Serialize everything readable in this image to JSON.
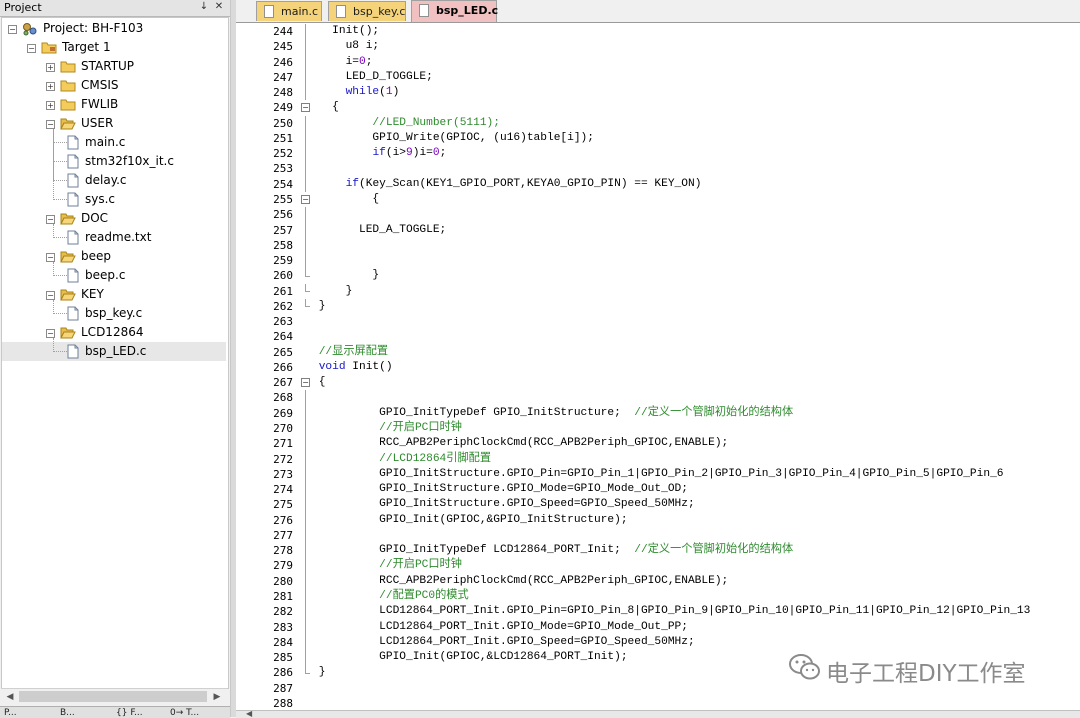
{
  "project_panel": {
    "title": "Project",
    "pin_glyph": "↓",
    "close_glyph": "✕",
    "tree": [
      {
        "label": "Project: BH-F103",
        "type": "project"
      },
      {
        "label": "Target 1",
        "type": "target"
      },
      {
        "label": "STARTUP",
        "type": "folder",
        "state": "collapsed"
      },
      {
        "label": "CMSIS",
        "type": "folder",
        "state": "collapsed"
      },
      {
        "label": "FWLIB",
        "type": "folder",
        "state": "collapsed"
      },
      {
        "label": "USER",
        "type": "folder",
        "state": "expanded"
      },
      {
        "label": "main.c",
        "type": "file"
      },
      {
        "label": "stm32f10x_it.c",
        "type": "file"
      },
      {
        "label": "delay.c",
        "type": "file"
      },
      {
        "label": "sys.c",
        "type": "file"
      },
      {
        "label": "DOC",
        "type": "folder",
        "state": "expanded"
      },
      {
        "label": "readme.txt",
        "type": "file"
      },
      {
        "label": "beep",
        "type": "folder",
        "state": "expanded"
      },
      {
        "label": "beep.c",
        "type": "file"
      },
      {
        "label": "KEY",
        "type": "folder",
        "state": "expanded"
      },
      {
        "label": "bsp_key.c",
        "type": "file"
      },
      {
        "label": "LCD12864",
        "type": "folder",
        "state": "expanded"
      },
      {
        "label": "bsp_LED.c",
        "type": "file",
        "selected": true
      }
    ],
    "bottom_tabs": [
      "P...",
      "B...",
      "{} F...",
      "0→ T..."
    ]
  },
  "editor": {
    "tabs": [
      {
        "label": "main.c",
        "active": false
      },
      {
        "label": "bsp_key.c",
        "active": false
      },
      {
        "label": "bsp_LED.c",
        "active": true
      }
    ],
    "lines": [
      {
        "n": "244",
        "fold": "line",
        "segs": [
          {
            "t": "   Init();",
            "c": ""
          }
        ]
      },
      {
        "n": "245",
        "fold": "line",
        "segs": [
          {
            "t": "     u8 i;",
            "c": ""
          }
        ]
      },
      {
        "n": "246",
        "fold": "line",
        "segs": [
          {
            "t": "     i=",
            "c": ""
          },
          {
            "t": "0",
            "c": "num"
          },
          {
            "t": ";",
            "c": ""
          }
        ]
      },
      {
        "n": "247",
        "fold": "line",
        "segs": [
          {
            "t": "     LED_D_TOGGLE;",
            "c": ""
          }
        ]
      },
      {
        "n": "248",
        "fold": "line",
        "segs": [
          {
            "t": "     ",
            "c": ""
          },
          {
            "t": "while",
            "c": "kw"
          },
          {
            "t": "(",
            "c": ""
          },
          {
            "t": "1",
            "c": "num"
          },
          {
            "t": ")",
            "c": ""
          }
        ]
      },
      {
        "n": "249",
        "fold": "box",
        "segs": [
          {
            "t": "   {",
            "c": ""
          }
        ]
      },
      {
        "n": "250",
        "fold": "line",
        "segs": [
          {
            "t": "         //LED_Number(5111);",
            "c": "cmt"
          }
        ]
      },
      {
        "n": "251",
        "fold": "line",
        "segs": [
          {
            "t": "         GPIO_Write(GPIOC, (u16)table[i]);",
            "c": ""
          }
        ]
      },
      {
        "n": "252",
        "fold": "line",
        "segs": [
          {
            "t": "         ",
            "c": ""
          },
          {
            "t": "if",
            "c": "kw"
          },
          {
            "t": "(i>",
            "c": ""
          },
          {
            "t": "9",
            "c": "num"
          },
          {
            "t": ")i=",
            "c": ""
          },
          {
            "t": "0",
            "c": "num"
          },
          {
            "t": ";",
            "c": ""
          }
        ]
      },
      {
        "n": "253",
        "fold": "line",
        "segs": [
          {
            "t": "",
            "c": ""
          }
        ]
      },
      {
        "n": "254",
        "fold": "line",
        "segs": [
          {
            "t": "     ",
            "c": ""
          },
          {
            "t": "if",
            "c": "kw"
          },
          {
            "t": "(Key_Scan(KEY1_GPIO_PORT,KEYA0_GPIO_PIN) == KEY_ON)",
            "c": ""
          }
        ]
      },
      {
        "n": "255",
        "fold": "box",
        "segs": [
          {
            "t": "         {",
            "c": ""
          }
        ]
      },
      {
        "n": "256",
        "fold": "line",
        "segs": [
          {
            "t": "",
            "c": ""
          }
        ]
      },
      {
        "n": "257",
        "fold": "line",
        "segs": [
          {
            "t": "       LED_A_TOGGLE;",
            "c": ""
          }
        ]
      },
      {
        "n": "258",
        "fold": "line",
        "segs": [
          {
            "t": "",
            "c": ""
          }
        ]
      },
      {
        "n": "259",
        "fold": "line",
        "segs": [
          {
            "t": "",
            "c": ""
          }
        ]
      },
      {
        "n": "260",
        "fold": "end",
        "segs": [
          {
            "t": "         }",
            "c": ""
          }
        ]
      },
      {
        "n": "261",
        "fold": "end",
        "segs": [
          {
            "t": "     }",
            "c": ""
          }
        ]
      },
      {
        "n": "262",
        "fold": "end",
        "segs": [
          {
            "t": " }",
            "c": ""
          }
        ]
      },
      {
        "n": "263",
        "fold": "",
        "segs": [
          {
            "t": "",
            "c": ""
          }
        ]
      },
      {
        "n": "264",
        "fold": "",
        "segs": [
          {
            "t": "",
            "c": ""
          }
        ]
      },
      {
        "n": "265",
        "fold": "",
        "segs": [
          {
            "t": " //显示屏配置",
            "c": "cmt"
          }
        ]
      },
      {
        "n": "266",
        "fold": "",
        "segs": [
          {
            "t": " ",
            "c": ""
          },
          {
            "t": "void",
            "c": "kw"
          },
          {
            "t": " Init()",
            "c": ""
          }
        ]
      },
      {
        "n": "267",
        "fold": "box",
        "segs": [
          {
            "t": " {",
            "c": ""
          }
        ]
      },
      {
        "n": "268",
        "fold": "line",
        "segs": [
          {
            "t": "",
            "c": ""
          }
        ]
      },
      {
        "n": "269",
        "fold": "line",
        "segs": [
          {
            "t": "          GPIO_InitTypeDef GPIO_InitStructure;  ",
            "c": ""
          },
          {
            "t": "//定义一个管脚初始化的结构体",
            "c": "cmt"
          }
        ]
      },
      {
        "n": "270",
        "fold": "line",
        "segs": [
          {
            "t": "          //开启PC口时钟",
            "c": "cmt"
          }
        ]
      },
      {
        "n": "271",
        "fold": "line",
        "segs": [
          {
            "t": "          RCC_APB2PeriphClockCmd(RCC_APB2Periph_GPIOC,ENABLE);",
            "c": ""
          }
        ]
      },
      {
        "n": "272",
        "fold": "line",
        "segs": [
          {
            "t": "          //LCD12864引脚配置",
            "c": "cmt"
          }
        ]
      },
      {
        "n": "273",
        "fold": "line",
        "segs": [
          {
            "t": "          GPIO_InitStructure.GPIO_Pin=GPIO_Pin_1|GPIO_Pin_2|GPIO_Pin_3|GPIO_Pin_4|GPIO_Pin_5|GPIO_Pin_6",
            "c": ""
          }
        ]
      },
      {
        "n": "274",
        "fold": "line",
        "segs": [
          {
            "t": "          GPIO_InitStructure.GPIO_Mode=GPIO_Mode_Out_OD;",
            "c": ""
          }
        ]
      },
      {
        "n": "275",
        "fold": "line",
        "segs": [
          {
            "t": "          GPIO_InitStructure.GPIO_Speed=GPIO_Speed_50MHz;",
            "c": ""
          }
        ]
      },
      {
        "n": "276",
        "fold": "line",
        "segs": [
          {
            "t": "          GPIO_Init(GPIOC,&GPIO_InitStructure);",
            "c": ""
          }
        ]
      },
      {
        "n": "277",
        "fold": "line",
        "segs": [
          {
            "t": "",
            "c": ""
          }
        ]
      },
      {
        "n": "278",
        "fold": "line",
        "segs": [
          {
            "t": "          GPIO_InitTypeDef LCD12864_PORT_Init;  ",
            "c": ""
          },
          {
            "t": "//定义一个管脚初始化的结构体",
            "c": "cmt"
          }
        ]
      },
      {
        "n": "279",
        "fold": "line",
        "segs": [
          {
            "t": "          //开启PC口时钟",
            "c": "cmt"
          }
        ]
      },
      {
        "n": "280",
        "fold": "line",
        "segs": [
          {
            "t": "          RCC_APB2PeriphClockCmd(RCC_APB2Periph_GPIOC,ENABLE);",
            "c": ""
          }
        ]
      },
      {
        "n": "281",
        "fold": "line",
        "segs": [
          {
            "t": "          //配置PC0的模式",
            "c": "cmt"
          }
        ]
      },
      {
        "n": "282",
        "fold": "line",
        "segs": [
          {
            "t": "          LCD12864_PORT_Init.GPIO_Pin=GPIO_Pin_8|GPIO_Pin_9|GPIO_Pin_10|GPIO_Pin_11|GPIO_Pin_12|GPIO_Pin_13",
            "c": ""
          }
        ]
      },
      {
        "n": "283",
        "fold": "line",
        "segs": [
          {
            "t": "          LCD12864_PORT_Init.GPIO_Mode=GPIO_Mode_Out_PP;",
            "c": ""
          }
        ]
      },
      {
        "n": "284",
        "fold": "line",
        "segs": [
          {
            "t": "          LCD12864_PORT_Init.GPIO_Speed=GPIO_Speed_50MHz;",
            "c": ""
          }
        ]
      },
      {
        "n": "285",
        "fold": "line",
        "segs": [
          {
            "t": "          GPIO_Init(GPIOC,&LCD12864_PORT_Init);",
            "c": ""
          }
        ]
      },
      {
        "n": "286",
        "fold": "end",
        "segs": [
          {
            "t": " }",
            "c": ""
          }
        ]
      },
      {
        "n": "287",
        "fold": "",
        "segs": [
          {
            "t": "",
            "c": ""
          }
        ]
      },
      {
        "n": "288",
        "fold": "",
        "segs": [
          {
            "t": "",
            "c": ""
          }
        ]
      }
    ]
  },
  "watermark": {
    "text": "电子工程DIY工作室",
    "icon": "wechat-icon"
  },
  "colors": {
    "comment": "#2e8b2e",
    "keyword": "#1818c8",
    "number": "#7a00c0",
    "active_tab": "#f1c1c1",
    "tab_folder": "#f4d37a"
  }
}
